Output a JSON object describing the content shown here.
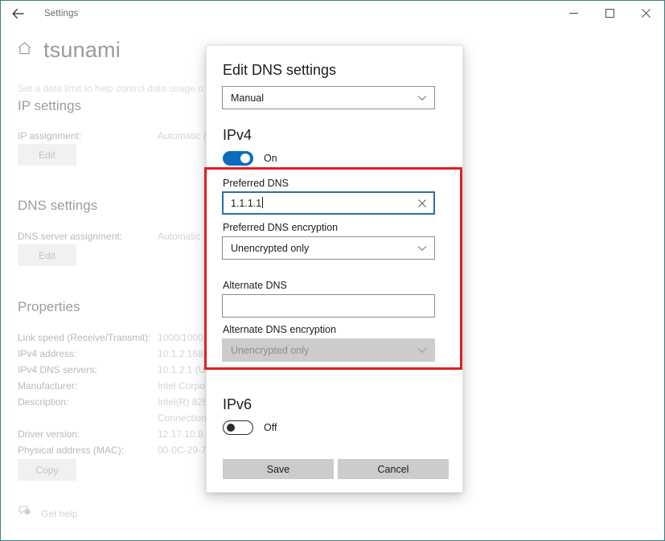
{
  "window": {
    "app_title": "Settings",
    "back_icon": "back-arrow-icon",
    "minimize_label": "–",
    "maximize_label": "☐",
    "close_label": "×"
  },
  "page": {
    "home_icon": "home-icon",
    "title": "tsunami",
    "subtitle": "Set a data limit to help control data usage on",
    "sections": [
      {
        "title": "IP settings",
        "rows": [
          {
            "label": "IP assignment:",
            "value": "Automatic ("
          }
        ],
        "button": "Edit"
      },
      {
        "title": "DNS settings",
        "rows": [
          {
            "label": "DNS server assignment:",
            "value": "Automatic"
          }
        ],
        "button": "Edit"
      }
    ],
    "properties": {
      "title": "Properties",
      "rows": [
        {
          "label": "Link speed (Receive/Transmit):",
          "value": "1000/1000 ("
        },
        {
          "label": "IPv4 address:",
          "value": "10.1.2.168"
        },
        {
          "label": "IPv4 DNS servers:",
          "value": "10.1.2.1 (Un"
        },
        {
          "label": "Manufacturer:",
          "value": "Intel Corpo"
        },
        {
          "label": "Description:",
          "value": "Intel(R) 825"
        },
        {
          "label": "",
          "value": "Connection"
        },
        {
          "label": "Driver version:",
          "value": "12.17.10.8"
        },
        {
          "label": "Physical address (MAC):",
          "value": "00-0C-29-7"
        }
      ],
      "copy_button": "Copy"
    },
    "get_help": {
      "icon": "help-bubble-icon",
      "label": "Get help"
    }
  },
  "dialog": {
    "title": "Edit DNS settings",
    "mode_select": {
      "value": "Manual",
      "chevron_icon": "chevron-down-icon"
    },
    "ipv4": {
      "heading": "IPv4",
      "toggle_state": "on",
      "toggle_label": "On",
      "preferred_dns_label": "Preferred DNS",
      "preferred_dns_value": "1.1.1.1",
      "preferred_dns_clear_icon": "clear-x-icon",
      "preferred_encryption_label": "Preferred DNS encryption",
      "preferred_encryption_value": "Unencrypted only",
      "alternate_dns_label": "Alternate DNS",
      "alternate_dns_value": "",
      "alternate_encryption_label": "Alternate DNS encryption",
      "alternate_encryption_value": "Unencrypted only"
    },
    "ipv6": {
      "heading": "IPv6",
      "toggle_state": "off",
      "toggle_label": "Off"
    },
    "save_label": "Save",
    "cancel_label": "Cancel"
  },
  "annotation": {
    "highlight_color": "#e02020"
  }
}
